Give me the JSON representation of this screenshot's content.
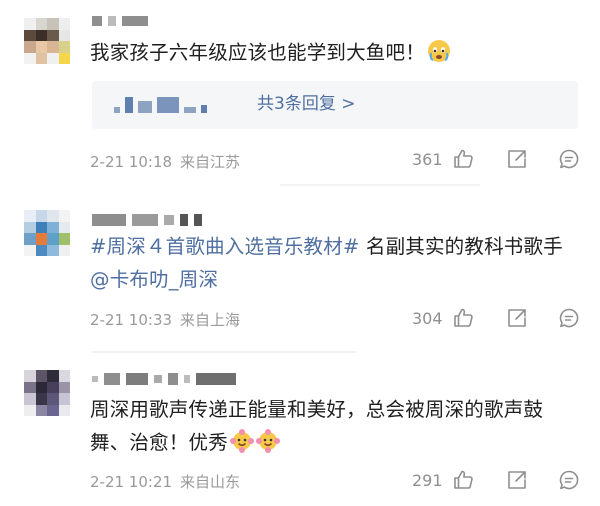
{
  "comments": [
    {
      "text": "我家孩子六年级应该也能学到大鱼吧！",
      "emoji": "crying-face",
      "reply_link": "共3条回复 >",
      "time": "2-21 10:18",
      "location": "来自江苏",
      "likes": "361"
    },
    {
      "topic": "#周深４首歌曲入选音乐教材#",
      "text": " 名副其实的教科书歌手 ",
      "mention": "@卡布叻_周深",
      "time": "2-21 10:33",
      "location": "来自上海",
      "likes": "304"
    },
    {
      "text": "周深用歌声传递正能量和美好，总会被周深的歌声鼓舞、治愈！优秀",
      "emoji": "flower-face",
      "time": "2-21 10:21",
      "location": "来自山东",
      "likes": "291"
    }
  ],
  "colors": {
    "link": "#4e6fa0",
    "meta": "#9a9a9a",
    "reply_bg": "#f5f6f8"
  }
}
